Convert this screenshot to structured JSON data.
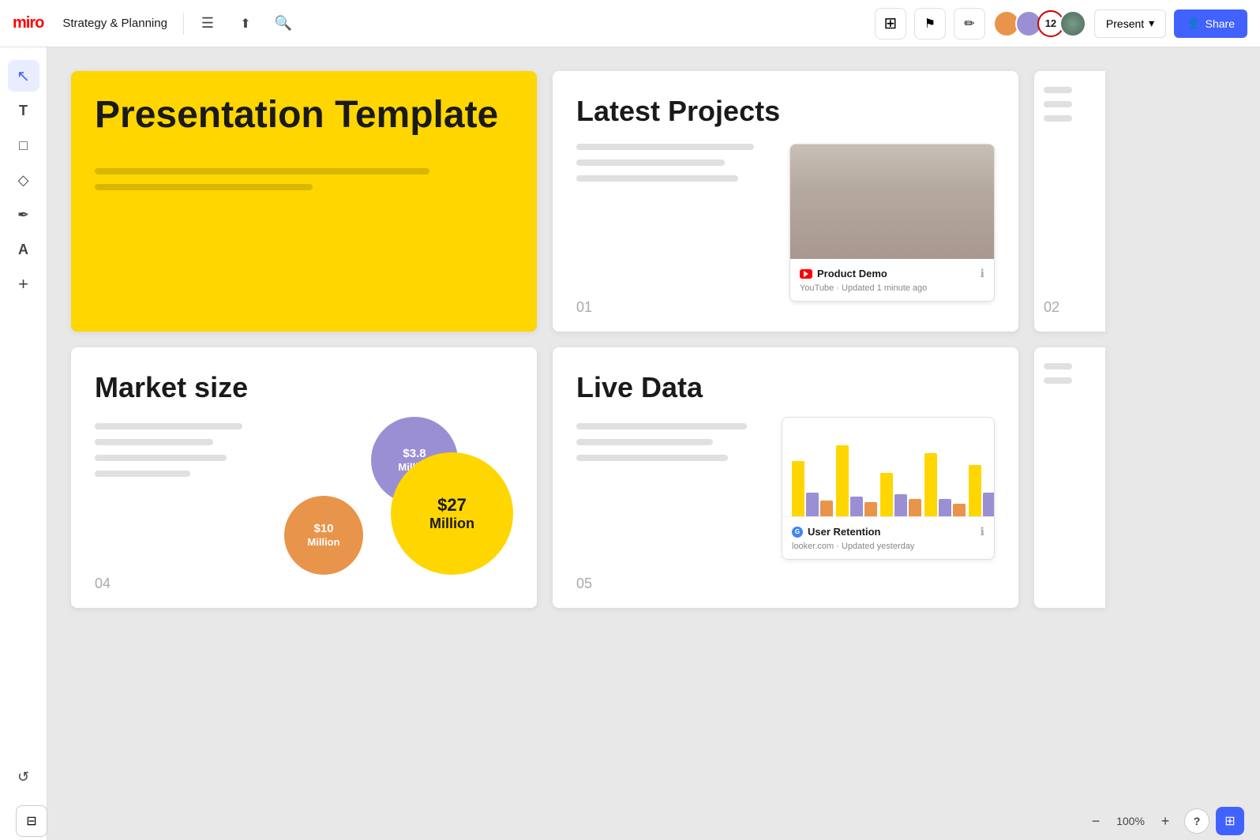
{
  "topbar": {
    "logo": "miro",
    "board_title": "Strategy & Planning",
    "menu_icon": "☰",
    "upload_icon": "↑",
    "search_icon": "🔍",
    "smart_btn_icon": "⊞",
    "cursor_icon": "↗",
    "collab_icon": "✏",
    "avatar_count": "12",
    "present_label": "Present",
    "present_chevron": "▾",
    "share_icon": "👤",
    "share_label": "Share"
  },
  "sidebar": {
    "select_icon": "↖",
    "text_icon": "T",
    "note_icon": "□",
    "shapes_icon": "◇",
    "pen_icon": "/",
    "marker_icon": "A",
    "plus_icon": "+",
    "undo_icon": "↺",
    "redo_icon": "↻",
    "panel_icon": "⊟"
  },
  "bottombar": {
    "zoom_minus": "−",
    "zoom_level": "100%",
    "zoom_plus": "+",
    "help_label": "?",
    "nav_icon": "⊞"
  },
  "cards": {
    "presentation": {
      "title": "Presentation Template",
      "line1_width": "70%",
      "line2_width": "45%"
    },
    "latest_projects": {
      "title": "Latest Projects",
      "number": "01",
      "video_title": "Product Demo",
      "video_source": "YouTube",
      "video_updated": "Updated 1 minute ago"
    },
    "partial_card": {
      "number": "02"
    },
    "market_size": {
      "title": "Market size",
      "number": "04",
      "bubble1_value": "$3.8",
      "bubble1_unit": "Million",
      "bubble2_value": "$10",
      "bubble2_unit": "Million",
      "bubble3_value": "$27",
      "bubble3_unit": "Million"
    },
    "live_data": {
      "title": "Live Data",
      "number": "05",
      "chart_title": "User Retention",
      "chart_source": "looker.com",
      "chart_updated": "Updated yesterday"
    }
  }
}
